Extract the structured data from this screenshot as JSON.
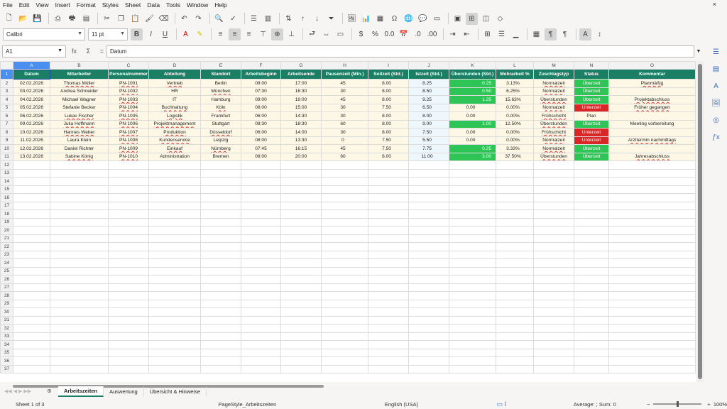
{
  "menu": [
    "File",
    "Edit",
    "View",
    "Insert",
    "Format",
    "Styles",
    "Sheet",
    "Data",
    "Tools",
    "Window",
    "Help"
  ],
  "window_close": "×",
  "font_name": "Calibri",
  "font_size": "11 pt",
  "name_box": "A1",
  "formula_content": "Datum",
  "formula_icons": {
    "fx": "fx",
    "sum": "Σ",
    "eq": "="
  },
  "columns": [
    "A",
    "B",
    "C",
    "D",
    "E",
    "F",
    "G",
    "H",
    "I",
    "J",
    "K",
    "L",
    "M",
    "N",
    "O"
  ],
  "headers": [
    "Datum",
    "Mitarbeiter",
    "Personalnummer",
    "Abteilung",
    "Standort",
    "Arbeitsbeginn",
    "Arbeitsende",
    "Pausenzeit (Min.)",
    "Sollzeit (Std.)",
    "Istzeit (Std.)",
    "Überstunden (Std.)",
    "Mehrarbeit %",
    "Zuschlagstyp",
    "Status",
    "Kommentar"
  ],
  "rows": [
    [
      "02.02.2026",
      "Thomas Müller",
      "PN-1001",
      "Vertrieb",
      "Berlin",
      "08:00",
      "17:00",
      "45",
      "8.00",
      "8.25",
      "0.25",
      "3.13%",
      "Normalzeit",
      "Überzeit",
      "Planmäßig"
    ],
    [
      "03.02.2026",
      "Andrea Schneider",
      "PN-1002",
      "HR",
      "München",
      "07:30",
      "16:30",
      "30",
      "8.00",
      "8.50",
      "0.50",
      "6.25%",
      "Normalzeit",
      "Überzeit",
      ""
    ],
    [
      "04.02.2026",
      "Michael Wagner",
      "PN-1003",
      "IT",
      "Hamburg",
      "09:00",
      "19:00",
      "45",
      "8.00",
      "9.25",
      "1.25",
      "15.63%",
      "Überstunden",
      "Überzeit",
      "Projektabschluss"
    ],
    [
      "05.02.2026",
      "Stefanie Becker",
      "PN-1004",
      "Buchhaltung",
      "Köln",
      "08:00",
      "15:00",
      "30",
      "7.50",
      "6.50",
      "0.00",
      "0.00%",
      "Normalzeit",
      "Unterzeit",
      "Früher gegangen"
    ],
    [
      "06.02.2026",
      "Lukas Fischer",
      "PN-1005",
      "Logistik",
      "Frankfurt",
      "06:00",
      "14:30",
      "30",
      "8.00",
      "8.00",
      "0.00",
      "0.00%",
      "Frühschicht",
      "Plan",
      ""
    ],
    [
      "09.02.2026",
      "Julia Hoffmann",
      "PN-1006",
      "Projektmanagement",
      "Stuttgart",
      "08:30",
      "18:30",
      "60",
      "8.00",
      "9.00",
      "1.00",
      "12.50%",
      "Überstunden",
      "Überzeit",
      "Meeting vorbereitung"
    ],
    [
      "10.02.2026",
      "Hannes Weber",
      "PN-1007",
      "Produktion",
      "Düsseldorf",
      "06:00",
      "14:00",
      "30",
      "8.00",
      "7.50",
      "0.00",
      "0.00%",
      "Frühschicht",
      "Unterzeit",
      ""
    ],
    [
      "11.02.2026",
      "Laura Klein",
      "PN-1008",
      "Kundenservice",
      "Leipzig",
      "08:00",
      "13:30",
      "0",
      "7.50",
      "5.50",
      "0.00",
      "0.00%",
      "Normalzeit",
      "Unterzeit",
      "Arzttermin nachmittags"
    ],
    [
      "12.02.2026",
      "Daniel Richter",
      "PN-1009",
      "Einkauf",
      "Nürnberg",
      "07:45",
      "16:15",
      "45",
      "7.50",
      "7.75",
      "0.25",
      "3.33%",
      "Normalzeit",
      "Überzeit",
      ""
    ],
    [
      "13.02.2026",
      "Sabine König",
      "PN-1010",
      "Administration",
      "Bremen",
      "08:00",
      "20:00",
      "60",
      "8.00",
      "11.00",
      "3.00",
      "37.50%",
      "Überstunden",
      "Überzeit",
      "Jahresabschluss"
    ]
  ],
  "row_numbers": [
    "1",
    "2",
    "3",
    "4",
    "5",
    "6",
    "7",
    "8",
    "9",
    "10",
    "11",
    "12",
    "13",
    "14",
    "15",
    "16",
    "17",
    "18",
    "19",
    "20",
    "21",
    "22",
    "23",
    "24",
    "25",
    "26",
    "27",
    "28",
    "29",
    "30",
    "31",
    "32",
    "33",
    "34",
    "35",
    "36",
    "37"
  ],
  "sheet_tabs": [
    "Arbeitszeiten",
    "Auswertung",
    "Übersicht & Hinweise"
  ],
  "active_tab": "Arbeitszeiten",
  "status": {
    "sheet": "Sheet 1 of 3",
    "page_style": "PageStyle_Arbeitszeiten",
    "language": "English (USA)",
    "summary": "Average: ; Sum: 0",
    "zoom": "100%"
  },
  "colors": {
    "header_bg": "#1a7f64",
    "row_bg": "#fdf8e6",
    "positive": "#2fc456",
    "negative": "#d92626",
    "selection": "#4a8ef0"
  }
}
